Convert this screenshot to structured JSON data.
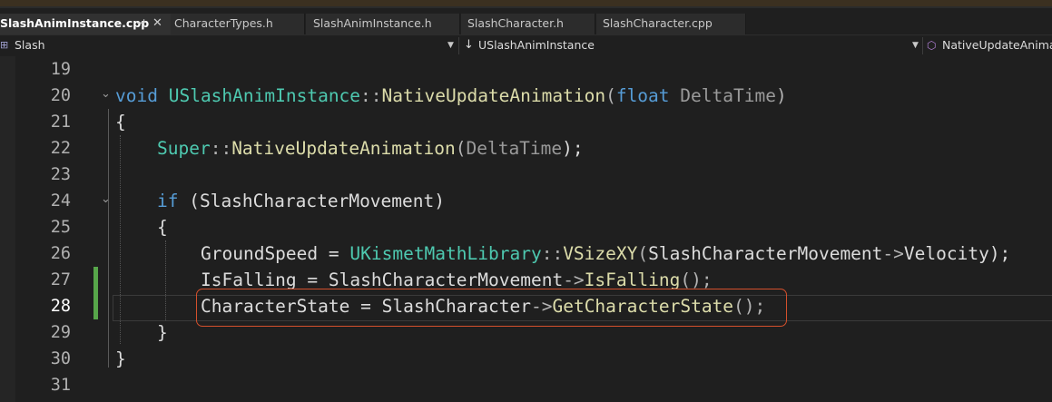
{
  "tabs": [
    {
      "label": "SlashAnimInstance.cpp",
      "active": true,
      "pin_icon": "pin-icon",
      "close_icon": "close-icon"
    },
    {
      "label": "CharacterTypes.h"
    },
    {
      "label": "SlashAnimInstance.h"
    },
    {
      "label": "SlashCharacter.h"
    },
    {
      "label": "SlashCharacter.cpp"
    }
  ],
  "navbar": {
    "project": "Slash",
    "scope": "USlashAnimInstance",
    "member": "NativeUpdateAnimat"
  },
  "line_numbers": [
    "19",
    "20",
    "21",
    "22",
    "23",
    "24",
    "25",
    "26",
    "27",
    "28",
    "29",
    "30",
    "31"
  ],
  "current_line": "28",
  "code": {
    "l20": {
      "kw": "void",
      "cls": "USlashAnimInstance",
      "sep": "::",
      "fn": "NativeUpdateAnimation",
      "open": "(",
      "type": "float",
      "param": "DeltaTime",
      "close": ")"
    },
    "l21": "{",
    "l22": {
      "cls": "Super",
      "sep": "::",
      "fn": "NativeUpdateAnimation",
      "open": "(",
      "param": "DeltaTime",
      "close": ");"
    },
    "l24": {
      "kw": "if",
      "rest": " (SlashCharacterMovement)"
    },
    "l25": "{",
    "l26": {
      "var": "GroundSpeed",
      "eq": " = ",
      "cls": "UKismetMathLibrary",
      "sep": "::",
      "fn": "VSizeXY",
      "open": "(",
      "obj": "SlashCharacterMovement",
      "arrow": "->",
      "member": "Velocity",
      "close": ");"
    },
    "l27": {
      "var": "IsFalling",
      "eq": " = ",
      "obj": "SlashCharacterMovement",
      "arrow": "->",
      "fn": "IsFalling",
      "close": "();"
    },
    "l28": {
      "var": "CharacterState",
      "eq": " = ",
      "obj": "SlashCharacter",
      "arrow": "->",
      "fn": "GetCharacterState",
      "close": "();"
    },
    "l29": "}",
    "l30": "}"
  },
  "colors": {
    "keyword": "#569cd6",
    "class": "#4ec9b0",
    "function": "#dcdcaa",
    "highlight_box": "#d4502c",
    "change_bar": "#57a64a"
  }
}
